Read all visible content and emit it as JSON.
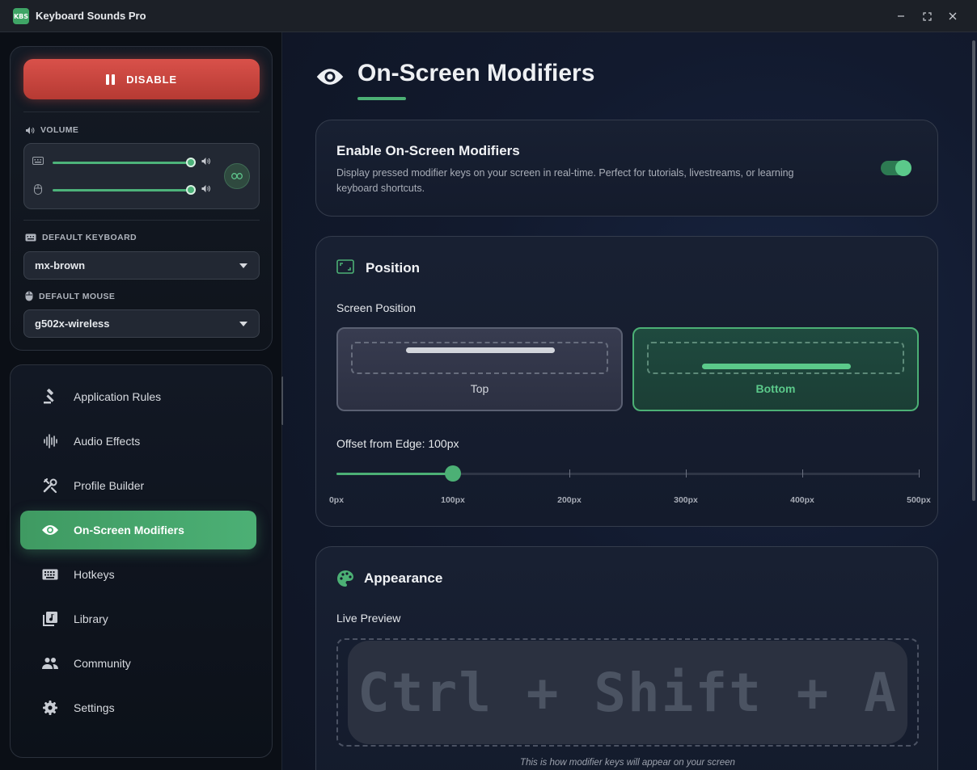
{
  "window": {
    "logo_text": "KBS",
    "title": "Keyboard Sounds Pro",
    "controls": [
      "minimize-icon",
      "maximize-icon",
      "close-icon"
    ]
  },
  "control_panel": {
    "disable_label": "DISABLE",
    "volume_label": "VOLUME",
    "keyboard_volume": 0.92,
    "mouse_volume": 0.92,
    "default_keyboard_label": "DEFAULT KEYBOARD",
    "default_keyboard_value": "mx-brown",
    "default_mouse_label": "DEFAULT MOUSE",
    "default_mouse_value": "g502x-wireless"
  },
  "nav": {
    "items": [
      {
        "label": "Application Rules",
        "icon": "gavel-icon"
      },
      {
        "label": "Audio Effects",
        "icon": "waveform-icon"
      },
      {
        "label": "Profile Builder",
        "icon": "tools-icon"
      },
      {
        "label": "On-Screen Modifiers",
        "icon": "eye-icon",
        "active": true
      },
      {
        "label": "Hotkeys",
        "icon": "keyboard-icon"
      },
      {
        "label": "Library",
        "icon": "library-icon"
      },
      {
        "label": "Community",
        "icon": "people-icon"
      },
      {
        "label": "Settings",
        "icon": "gear-icon"
      }
    ]
  },
  "page": {
    "title": "On-Screen Modifiers",
    "enable_card": {
      "title": "Enable On-Screen Modifiers",
      "description": "Display pressed modifier keys on your screen in real-time. Perfect for tutorials, livestreams, or learning keyboard shortcuts.",
      "enabled": true
    },
    "position_card": {
      "title": "Position",
      "screen_position_label": "Screen Position",
      "options": [
        "Top",
        "Bottom"
      ],
      "selected": "Bottom",
      "offset_label": "Offset from Edge: 100px",
      "offset_value": 100,
      "offset_max": 500,
      "ticks": [
        "0px",
        "100px",
        "200px",
        "300px",
        "400px",
        "500px"
      ]
    },
    "appearance_card": {
      "title": "Appearance",
      "live_preview_label": "Live Preview",
      "preview_text": "Ctrl + Shift + A",
      "caption": "This is how modifier keys will appear on your screen"
    }
  },
  "colors": {
    "accent": "#4cb075",
    "danger": "#d9514a",
    "background": "#0f1626"
  }
}
